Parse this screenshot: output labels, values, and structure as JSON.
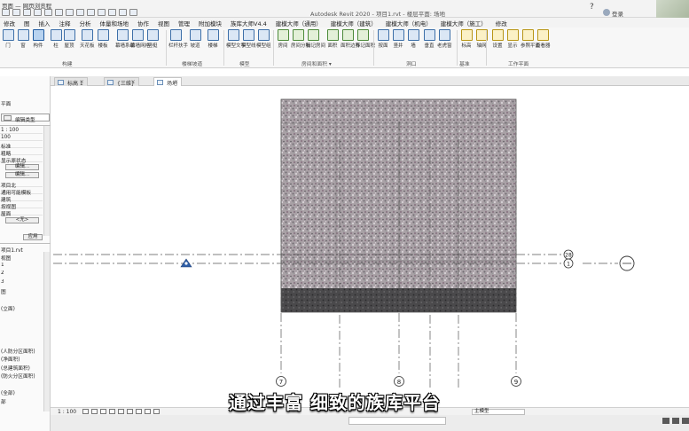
{
  "window": {
    "doc_label": "页面 — 网页浏览程",
    "title": "Autodesk Revit 2020 - 项目1.rvt - 楼层平面: 场地",
    "user_label": "登录",
    "help_icon": "help-icon"
  },
  "menu": [
    "修改",
    "图",
    "插入",
    "注释",
    "分析",
    "体量和场地",
    "协作",
    "视图",
    "管理",
    "附加模块",
    "族库大师V4.4",
    "建模大师（通用）",
    "建模大师（建筑）",
    "建模大师（机电）",
    "建模大师（施工）",
    "修改"
  ],
  "ribbon": {
    "buttons": [
      {
        "label": "门"
      },
      {
        "label": "窗"
      },
      {
        "label": "构件",
        "active": true
      },
      {
        "label": "柱"
      },
      {
        "label": "屋顶"
      },
      {
        "label": "天花板"
      },
      {
        "label": "楼板"
      },
      {
        "label": "幕墙系统"
      },
      {
        "label": "幕墙网格"
      },
      {
        "label": "竖梃"
      },
      {
        "label": "栏杆扶手"
      },
      {
        "label": "坡道"
      },
      {
        "label": "楼梯"
      },
      {
        "label": "模型文字"
      },
      {
        "label": "模型线"
      },
      {
        "label": "模型组"
      },
      {
        "label": "房间"
      },
      {
        "label": "房间分隔"
      },
      {
        "label": "标记房间"
      },
      {
        "label": "面积"
      },
      {
        "label": "面积边界"
      },
      {
        "label": "标记面积"
      },
      {
        "label": "按面"
      },
      {
        "label": "竖井"
      },
      {
        "label": "墙"
      },
      {
        "label": "垂直"
      },
      {
        "label": "老虎窗"
      },
      {
        "label": "标高"
      },
      {
        "label": "轴网"
      },
      {
        "label": "设置"
      },
      {
        "label": "显示"
      },
      {
        "label": "参照平面"
      },
      {
        "label": "查看器"
      }
    ],
    "groups": [
      "构建",
      "楼梯坡道",
      "模型",
      "房间和面积 ▾",
      "洞口",
      "基准",
      "工作平面"
    ]
  },
  "left_panel": {
    "type_selector_label": "编辑类型",
    "rows": [
      "平面",
      "1 : 100",
      "100",
      "标准",
      "粗略",
      "显示原状态",
      "编辑...",
      "编辑...",
      "项目北",
      "通用可能模板",
      "建筑",
      "按视图",
      "屋面",
      "<无>"
    ],
    "apply_label": "应用",
    "browser_title": "项目1.rvt",
    "browser_rows": [
      "视图",
      "1",
      "2",
      "3",
      "图",
      "",
      "(立面)",
      "",
      "",
      "",
      "",
      "(人防分区面积)",
      "(净面积)",
      "(总建筑面积)",
      "(防火分区面积)",
      "",
      "(全部)",
      "部"
    ]
  },
  "tabs": [
    {
      "label": "标高 1",
      "active": false
    },
    {
      "label": "{三维}",
      "active": false
    },
    {
      "label": "场地",
      "active": true
    }
  ],
  "grid": {
    "vertical_labels": [
      "7",
      "8",
      "9"
    ],
    "horizontal_labels": [
      "28",
      "1"
    ]
  },
  "status": {
    "scale": "1 : 100",
    "model_label": "主模型"
  },
  "subtitle": "通过丰富 细致的族库平台"
}
